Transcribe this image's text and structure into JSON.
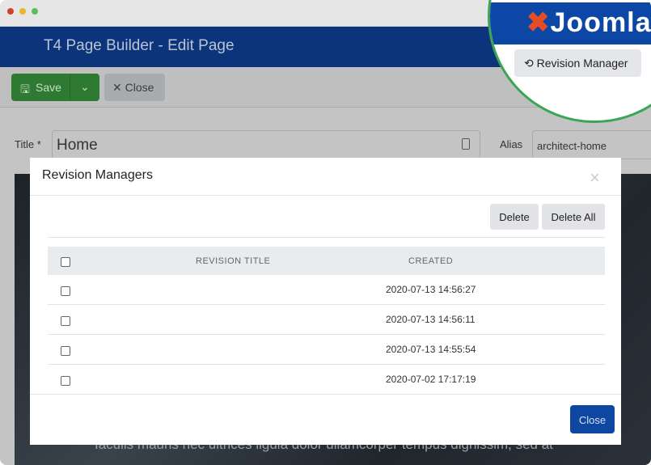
{
  "window": {
    "controls": [
      "close",
      "minimize",
      "maximize"
    ]
  },
  "header": {
    "title": "T4 Page Builder - Edit Page"
  },
  "toolbar": {
    "save_label": "Save",
    "close_label": "Close"
  },
  "form": {
    "title_label": "Title *",
    "title_value": "Home",
    "alias_label": "Alias",
    "alias_value": "architect-home"
  },
  "background_text": "Iaculis mauris nec ultrices ligula dolor ullamcorper tempus dignissim, sed at",
  "modal": {
    "title": "Revision Managers",
    "delete_label": "Delete",
    "delete_all_label": "Delete All",
    "columns": [
      "REVISION TITLE",
      "CREATED"
    ],
    "rows": [
      {
        "title": "",
        "created": "2020-07-13 14:56:27"
      },
      {
        "title": "",
        "created": "2020-07-13 14:56:11"
      },
      {
        "title": "",
        "created": "2020-07-13 14:55:54"
      },
      {
        "title": "",
        "created": "2020-07-02 17:17:19"
      }
    ],
    "close_label": "Close"
  },
  "magnifier": {
    "logo": "Joomla!",
    "button_label": "Revision Manager",
    "border_color": "#3aa556"
  },
  "colors": {
    "header": "#0c347a",
    "save": "#2e7a33",
    "primary": "#0d47a1"
  }
}
